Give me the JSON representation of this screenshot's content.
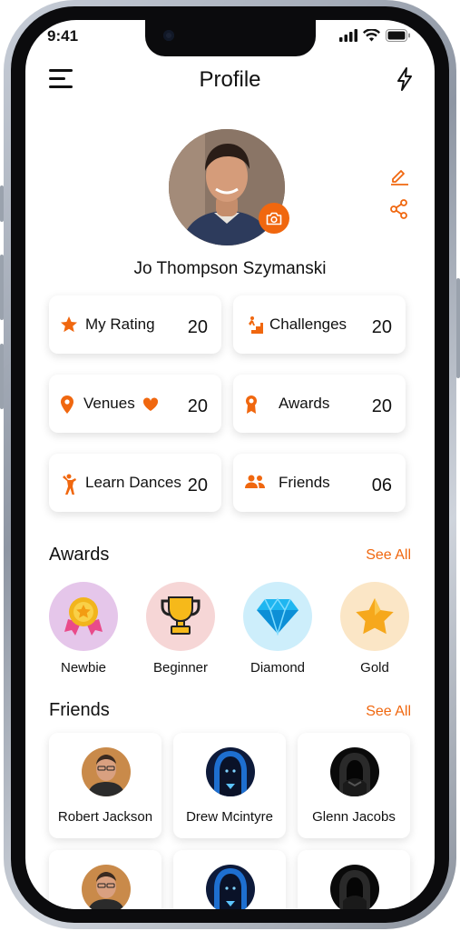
{
  "status": {
    "time": "9:41"
  },
  "header": {
    "title": "Profile"
  },
  "profile": {
    "name": "Jo Thompson Szymanski"
  },
  "stats": [
    {
      "label": "My Rating",
      "value": "20",
      "icon": "star-icon"
    },
    {
      "label": "Challenges",
      "value": "20",
      "icon": "stairs-climber-icon"
    },
    {
      "label": "Venues",
      "value": "20",
      "icon": "location-pin-icon"
    },
    {
      "label": "Awards",
      "value": "20",
      "icon": "award-ribbon-icon"
    },
    {
      "label": "Learn Dances",
      "value": "20",
      "icon": "dancer-icon"
    },
    {
      "label": "Friends",
      "value": "06",
      "icon": "people-icon"
    }
  ],
  "awards_section": {
    "title": "Awards",
    "see_all": "See All"
  },
  "awards": [
    {
      "label": "Newbie",
      "icon": "medal-icon",
      "bg": "#e5c6ea"
    },
    {
      "label": "Beginner",
      "icon": "trophy-icon",
      "bg": "#f6d6d6"
    },
    {
      "label": "Diamond",
      "icon": "diamond-icon",
      "bg": "#cdeefb"
    },
    {
      "label": "Gold",
      "icon": "gold-star-icon",
      "bg": "#fbe6c6"
    }
  ],
  "friends_section": {
    "title": "Friends",
    "see_all": "See All"
  },
  "friends": [
    {
      "name": "Robert Jackson"
    },
    {
      "name": "Drew Mcintyre"
    },
    {
      "name": "Glenn Jacobs"
    }
  ],
  "colors": {
    "accent": "#f0670f",
    "text": "#111111"
  }
}
